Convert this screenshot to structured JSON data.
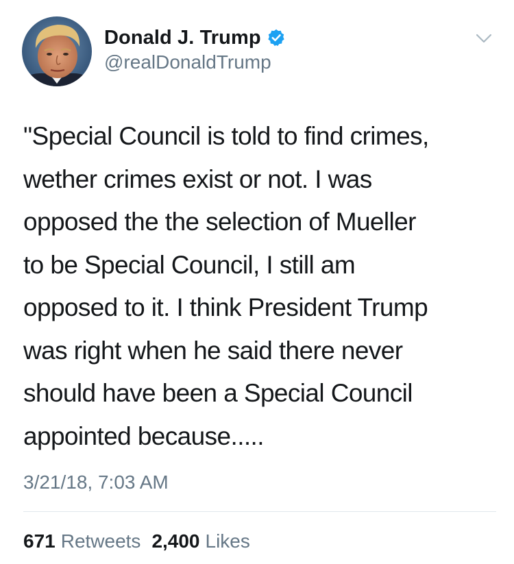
{
  "author": {
    "display_name": "Donald J. Trump",
    "handle": "@realDonaldTrump",
    "verified": true,
    "verified_icon": "verified-badge-icon",
    "avatar": "profile-photo"
  },
  "menu": {
    "icon": "chevron-down-icon"
  },
  "tweet": {
    "text": "\"Special Council is told to find crimes,\nwether crimes exist or not. I was\nopposed the the selection of Mueller\nto be Special Council, I still am\nopposed to it. I think President Trump\nwas right when he said there never\nshould have been a Special Council\nappointed because.....",
    "timestamp": "3/21/18, 7:03 AM"
  },
  "stats": {
    "retweets_count": "671",
    "retweets_label": "Retweets",
    "likes_count": "2,400",
    "likes_label": "Likes"
  },
  "colors": {
    "text_primary": "#14171a",
    "text_secondary": "#657786",
    "verified_blue": "#1da1f2",
    "divider": "#e1e8ed"
  }
}
